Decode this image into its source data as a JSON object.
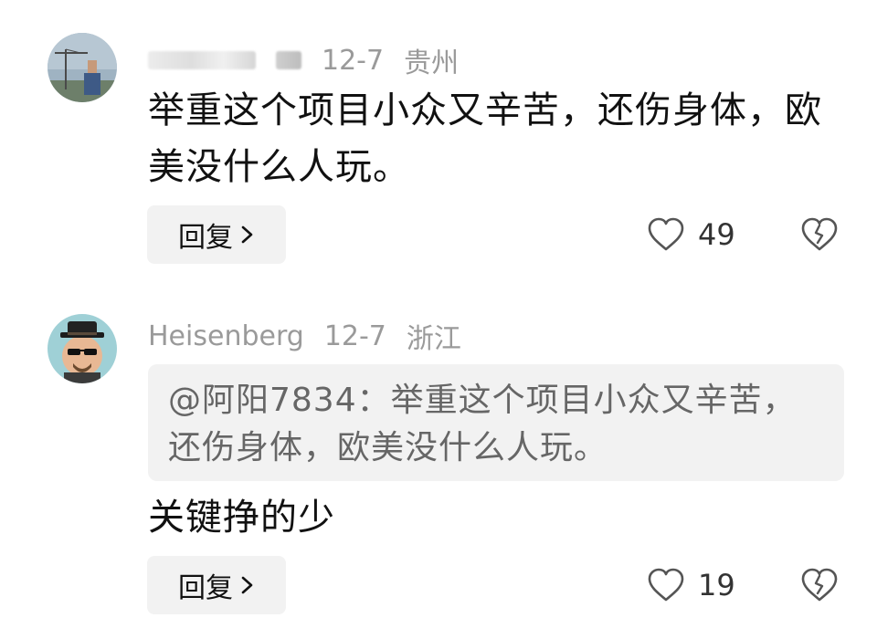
{
  "comments": [
    {
      "author": "",
      "date": "12-7",
      "location": "贵州",
      "text": "举重这个项目小众又辛苦，还伤身体，欧美没什么人玩。",
      "reply_label": "回复",
      "likes": "49",
      "avatar_icon": "construction-crane-photo"
    },
    {
      "author": "Heisenberg",
      "date": "12-7",
      "location": "浙江",
      "quote": "@阿阳7834：举重这个项目小众又辛苦，还伤身体，欧美没什么人玩。",
      "text": "关键挣的少",
      "reply_label": "回复",
      "likes": "19",
      "avatar_icon": "heisenberg-cartoon-avatar"
    }
  ],
  "icons": {
    "like": "heart-outline-icon",
    "dislike": "broken-heart-icon",
    "chevron": "chevron-right-icon"
  }
}
